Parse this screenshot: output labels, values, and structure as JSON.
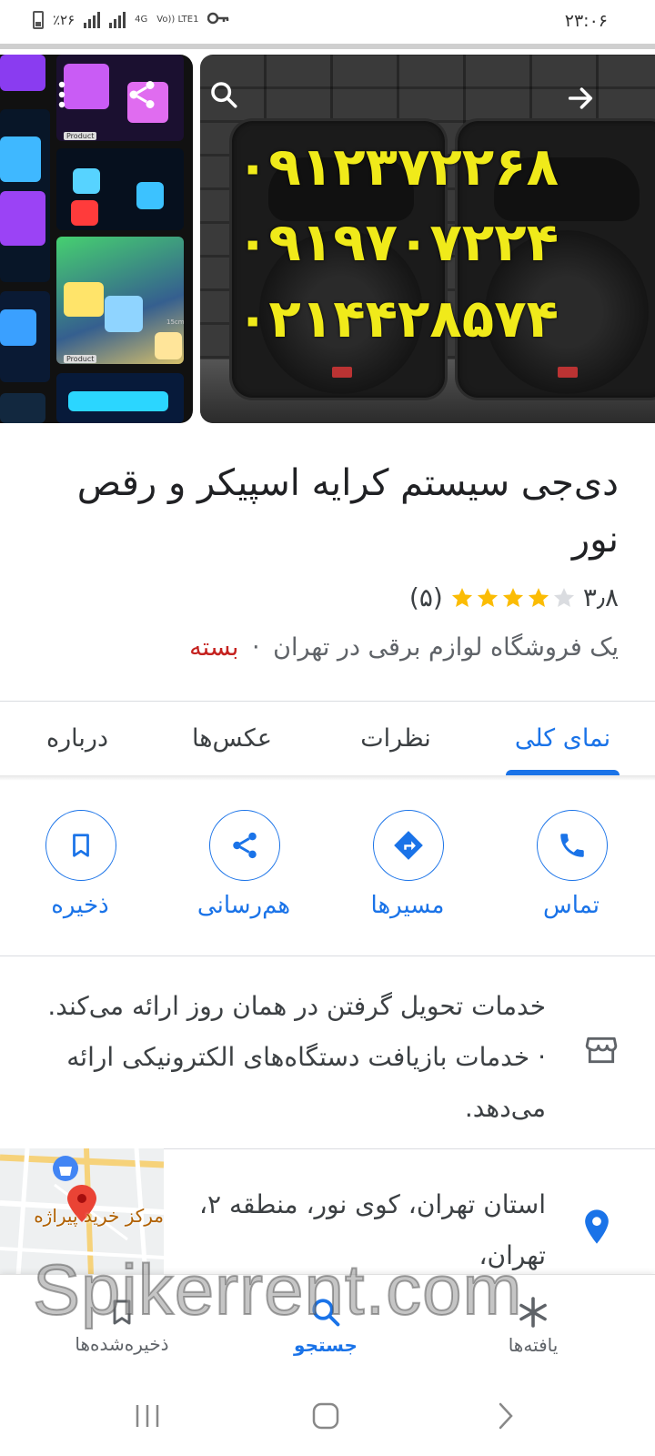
{
  "status_bar": {
    "battery_percent": "٪۲۶",
    "network": "4G",
    "volte": "Vo)) LTE1",
    "time": "۲۳:۰۶"
  },
  "photo_overlay": {
    "phone_lines": [
      "۰۹۱۲۳۷۲۲۶۸",
      "۰۹۱۹۷۰۷۲۲۴",
      "۰۲۱۴۴۲۸۵۷۴"
    ],
    "product_tag": "Product",
    "size_tag": "15cm"
  },
  "place": {
    "title": "دی‌جی سیستم کرایه اسپیکر و رقص نور",
    "rating": "۳٫۸",
    "rating_stars": 3.8,
    "review_count": "(۵)",
    "category": "یک فروشگاه لوازم برقی در تهران",
    "separator": "·",
    "status": "بسته"
  },
  "tabs": [
    {
      "label": "نمای کلی",
      "active": true
    },
    {
      "label": "نظرات",
      "active": false
    },
    {
      "label": "عکس‌ها",
      "active": false
    },
    {
      "label": "درباره",
      "active": false
    }
  ],
  "actions": {
    "call": "تماس",
    "directions": "مسیرها",
    "share": "هم‌رسانی",
    "save": "ذخیره"
  },
  "description": "خدمات تحویل گرفتن در همان روز ارائه می‌کند. · خدمات بازیافت دستگاه‌های الکترونیکی ارائه می‌دهد.",
  "map_label": "مرکز خرید پیراژه",
  "address": "استان تهران، کوی نور، منطقه ۲، تهران،",
  "bottom_nav": {
    "explore": "یافته‌ها",
    "search": "جستجو",
    "saved": "ذخیره‌شده‌ها"
  },
  "watermark": "Spikerrent.com",
  "colors": {
    "accent": "#1a73e8",
    "star": "#fbbc04",
    "closed": "#c5221f",
    "phone_text": "#f0ea1a"
  }
}
